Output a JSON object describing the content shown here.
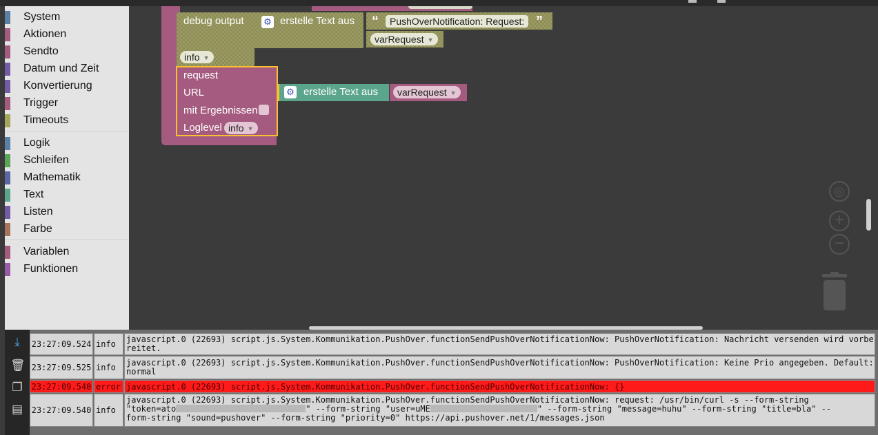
{
  "toolbox": {
    "groups": [
      [
        {
          "label": "System",
          "color": "#5b80a5"
        },
        {
          "label": "Aktionen",
          "color": "#a55b80"
        },
        {
          "label": "Sendto",
          "color": "#a55b80"
        },
        {
          "label": "Datum und Zeit",
          "color": "#745ba5"
        },
        {
          "label": "Konvertierung",
          "color": "#745ba5"
        },
        {
          "label": "Trigger",
          "color": "#a55b80"
        },
        {
          "label": "Timeouts",
          "color": "#a5a55b"
        }
      ],
      [
        {
          "label": "Logik",
          "color": "#5b80a5"
        },
        {
          "label": "Schleifen",
          "color": "#5ba55b"
        },
        {
          "label": "Mathematik",
          "color": "#5b67a5"
        },
        {
          "label": "Text",
          "color": "#5ba58c"
        },
        {
          "label": "Listen",
          "color": "#745ba5"
        },
        {
          "label": "Farbe",
          "color": "#a5745b"
        }
      ],
      [
        {
          "label": "Variablen",
          "color": "#a55b80"
        },
        {
          "label": "Funktionen",
          "color": "#995ba5"
        }
      ]
    ]
  },
  "blocks": {
    "debug_label": "debug output",
    "create_text_label": "erstelle Text aus",
    "string_literal": "PushOverNotification: Request:",
    "quote_open": "“",
    "quote_close": "”",
    "var_request": "varRequest",
    "info_level": "info",
    "request_label": "request",
    "url_label": "URL",
    "results_label": "mit Ergebnissen",
    "loglevel_label": "Loglevel",
    "loglevel_value": "info",
    "url_create_text_label": "erstelle Text aus",
    "url_var": "varRequest",
    "colors": {
      "debug_block": "#8f8f55",
      "request_block": "#a55b80",
      "text_block": "#5ba58c",
      "selected_outline": "#fbc02d"
    }
  },
  "log": {
    "rows": [
      {
        "time": "23:27:09.524",
        "level": "info",
        "message": "javascript.0 (22693) script.js.System.Kommunikation.PushOver.functionSendPushOverNotificationNow: PushOverNotification: Nachricht versenden wird vorbereitet.",
        "error": false
      },
      {
        "time": "23:27:09.525",
        "level": "info",
        "message": "javascript.0 (22693) script.js.System.Kommunikation.PushOver.functionSendPushOverNotificationNow: PushOverNotification: Keine Prio angegeben. Default: normal",
        "error": false
      },
      {
        "time": "23:27:09.540",
        "level": "error",
        "message": "javascript.0 (22693) script.js.System.Kommunikation.PushOver.functionSendPushOverNotificationNow: {}",
        "error": true
      }
    ],
    "curl_row": {
      "time": "23:27:09.540",
      "level": "info",
      "part1": "javascript.0 (22693) script.js.System.Kommunikation.PushOver.functionSendPushOverNotificationNow: request: /usr/bin/curl -s --form-string",
      "part2a": "\"token=ato",
      "part2b": "\" --form-string \"user=uME",
      "part2c": "\" --form-string \"message=huhu\" --form-string \"title=bla\" --",
      "part3": "form-string \"sound=pushover\" --form-string \"priority=0\" https://api.pushover.net/1/messages.json"
    }
  }
}
